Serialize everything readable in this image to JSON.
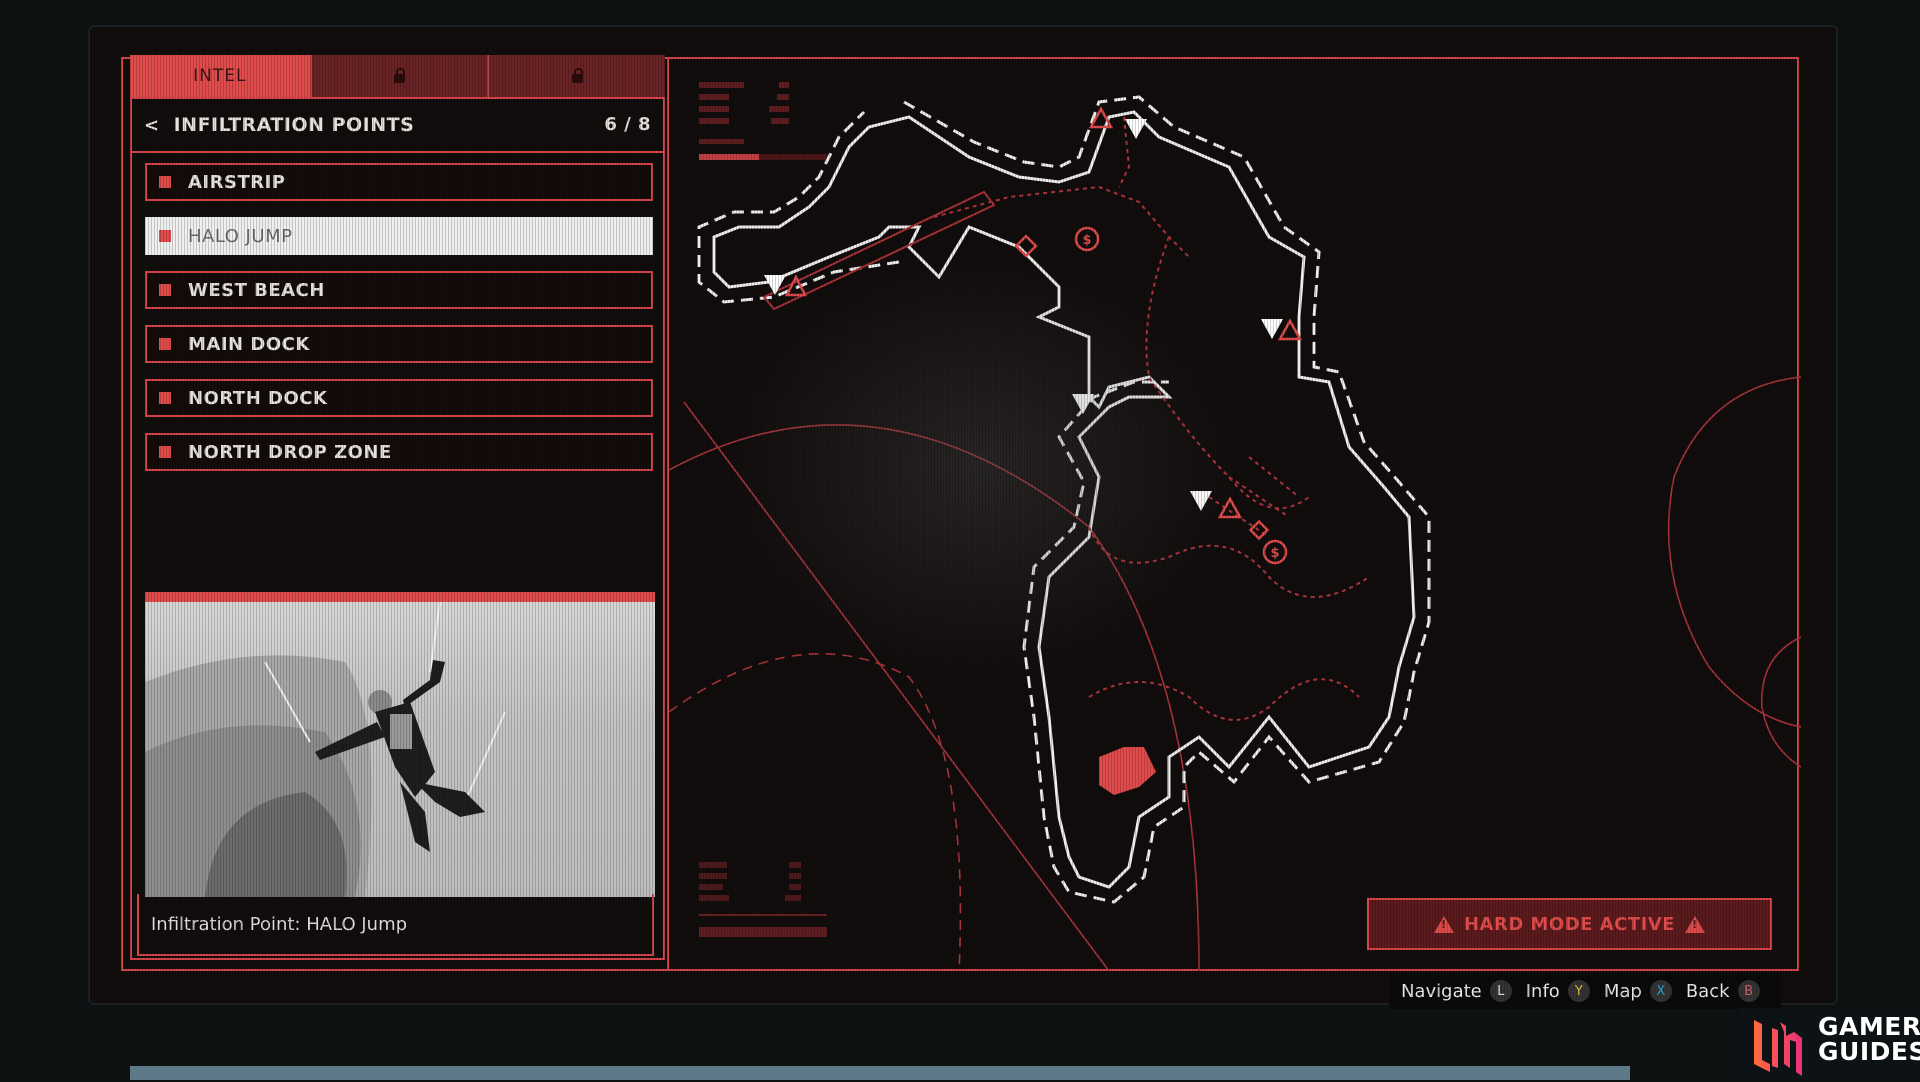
{
  "tabs": [
    {
      "label": "INTEL",
      "state": "active"
    },
    {
      "label": "",
      "state": "locked",
      "icon": "lock-icon"
    },
    {
      "label": "",
      "state": "locked",
      "icon": "lock-icon"
    }
  ],
  "panel": {
    "back_label": "<",
    "title": "INFILTRATION POINTS",
    "count": "6 / 8",
    "items": [
      {
        "label": "AIRSTRIP",
        "selected": false
      },
      {
        "label": "HALO JUMP",
        "selected": true
      },
      {
        "label": "WEST BEACH",
        "selected": false
      },
      {
        "label": "MAIN DOCK",
        "selected": false
      },
      {
        "label": "NORTH DOCK",
        "selected": false
      },
      {
        "label": "NORTH DROP ZONE",
        "selected": false
      }
    ],
    "preview_caption": "Infiltration Point: HALO Jump"
  },
  "map": {
    "markers": [
      {
        "type": "infiltration-point",
        "icon": "down-triangle-icon"
      },
      {
        "type": "enemy-camp",
        "icon": "warning-triangle-icon"
      },
      {
        "type": "objective",
        "icon": "diamond-icon"
      },
      {
        "type": "currency",
        "icon": "dollar-icon"
      },
      {
        "type": "selected-area",
        "icon": "highlight-zone"
      }
    ],
    "hard_mode_label": "HARD MODE ACTIVE"
  },
  "hints": [
    {
      "label": "Navigate",
      "button": "L",
      "color": "#e8e8e8"
    },
    {
      "label": "Info",
      "button": "Y",
      "color": "#e8c33a"
    },
    {
      "label": "Map",
      "button": "X",
      "color": "#2aa7d8"
    },
    {
      "label": "Back",
      "button": "B",
      "color": "#d0606a"
    }
  ],
  "watermark": {
    "line1": "GAMER",
    "line2": "GUIDES"
  },
  "colors": {
    "accent": "#e04c4c",
    "frame": "#d9464a",
    "selected_bg": "#eef0ee"
  }
}
